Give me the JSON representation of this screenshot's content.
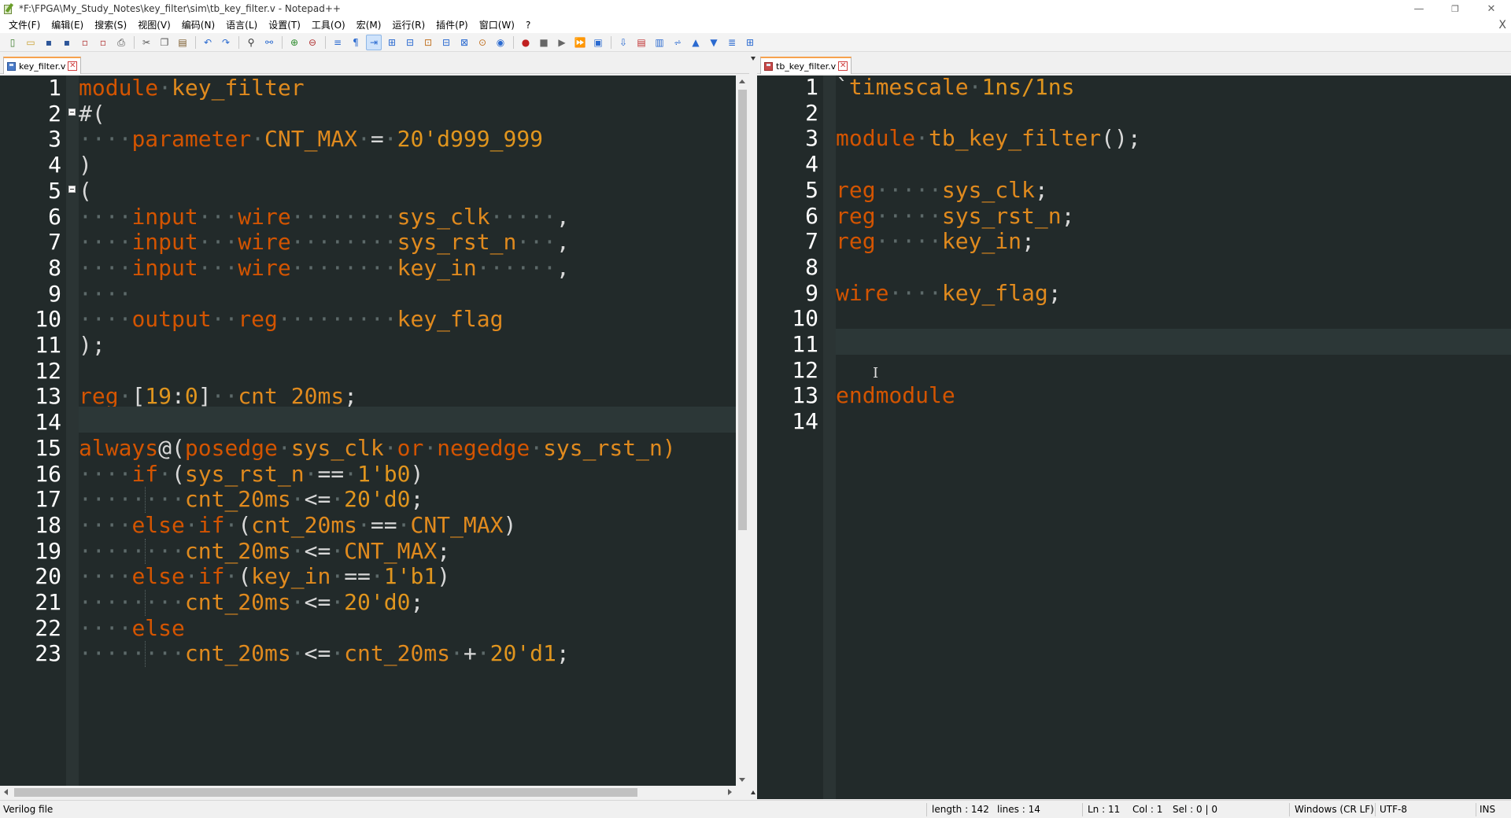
{
  "window": {
    "title": "*F:\\FPGA\\My_Study_Notes\\key_filter\\sim\\tb_key_filter.v - Notepad++",
    "minimize": "—",
    "restore": "❐",
    "close": "✕"
  },
  "menu": {
    "items": [
      "文件(F)",
      "编辑(E)",
      "搜索(S)",
      "视图(V)",
      "编码(N)",
      "语言(L)",
      "设置(T)",
      "工具(O)",
      "宏(M)",
      "运行(R)",
      "插件(P)",
      "窗口(W)",
      "?"
    ],
    "close": "X"
  },
  "toolbar": {
    "icons": [
      "new-file-icon",
      "open-file-icon",
      "save-icon",
      "save-all-icon",
      "close-icon",
      "close-all-icon",
      "print-icon",
      "cut-icon",
      "copy-icon",
      "paste-icon",
      "undo-icon",
      "redo-icon",
      "find-icon",
      "replace-icon",
      "zoom-in-icon",
      "zoom-out-icon",
      "sync-vertical-icon",
      "sync-horizontal-icon",
      "word-wrap-icon",
      "show-all-chars-icon",
      "indent-guide-icon",
      "udl-icon",
      "doc-map-icon",
      "function-list-icon",
      "folder-workspace-icon",
      "monitor-icon",
      "record-macro-icon",
      "stop-macro-icon",
      "play-macro-icon",
      "run-macro-multiple-icon",
      "save-macro-icon",
      "compare-icon",
      "compare-clear-icon",
      "compare-first-icon",
      "compare-prev-icon",
      "compare-next-icon",
      "compare-last-icon",
      "compare-nav-icon",
      "compare-panel-icon"
    ],
    "glyphs": [
      "▯",
      "▭",
      "▪",
      "▪",
      "▫",
      "▫",
      "⎙",
      "✂",
      "❐",
      "▤",
      "↶",
      "↷",
      "⚲",
      "⚯",
      "⊕",
      "⊖",
      "≡",
      "¶",
      "⇥",
      "⊞",
      "⊟",
      "⊡",
      "⊟",
      "⊠",
      "⊙",
      "◉",
      "●",
      "■",
      "▶",
      "⏩",
      "▣",
      "⇩",
      "▤",
      "▥",
      "⩫",
      "▲",
      "▼",
      "≣",
      "⊞"
    ],
    "active_index": 18
  },
  "left_pane": {
    "tab_label": "key_filter.v",
    "lines": [
      [
        [
          "kw",
          "module"
        ],
        [
          "ws",
          "·"
        ],
        [
          "id",
          "key_filter"
        ]
      ],
      [
        [
          "op",
          "#("
        ]
      ],
      [
        [
          "ws",
          "····"
        ],
        [
          "kw",
          "parameter"
        ],
        [
          "ws",
          "·"
        ],
        [
          "id",
          "CNT_MAX"
        ],
        [
          "ws",
          "·"
        ],
        [
          "op",
          "="
        ],
        [
          "ws",
          "·"
        ],
        [
          "num",
          "20'd999_999"
        ]
      ],
      [
        [
          "op",
          ")"
        ]
      ],
      [
        [
          "op",
          "("
        ]
      ],
      [
        [
          "ws",
          "····"
        ],
        [
          "kw",
          "input"
        ],
        [
          "ws",
          "···"
        ],
        [
          "kw",
          "wire"
        ],
        [
          "ws",
          "········"
        ],
        [
          "id",
          "sys_clk"
        ],
        [
          "ws",
          "·····"
        ],
        [
          "op",
          ","
        ]
      ],
      [
        [
          "ws",
          "····"
        ],
        [
          "kw",
          "input"
        ],
        [
          "ws",
          "···"
        ],
        [
          "kw",
          "wire"
        ],
        [
          "ws",
          "········"
        ],
        [
          "id",
          "sys_rst_n"
        ],
        [
          "ws",
          "···"
        ],
        [
          "op",
          ","
        ]
      ],
      [
        [
          "ws",
          "····"
        ],
        [
          "kw",
          "input"
        ],
        [
          "ws",
          "···"
        ],
        [
          "kw",
          "wire"
        ],
        [
          "ws",
          "········"
        ],
        [
          "id",
          "key_in"
        ],
        [
          "ws",
          "······"
        ],
        [
          "op",
          ","
        ]
      ],
      [
        [
          "ws",
          "····"
        ]
      ],
      [
        [
          "ws",
          "····"
        ],
        [
          "kw",
          "output"
        ],
        [
          "ws",
          "··"
        ],
        [
          "kw",
          "reg"
        ],
        [
          "ws",
          "·········"
        ],
        [
          "id",
          "key_flag"
        ]
      ],
      [
        [
          "op",
          ");"
        ]
      ],
      [],
      [
        [
          "kw",
          "reg"
        ],
        [
          "ws",
          "·"
        ],
        [
          "op",
          "["
        ],
        [
          "num",
          "19"
        ],
        [
          "op",
          ":"
        ],
        [
          "num",
          "0"
        ],
        [
          "op",
          "]"
        ],
        [
          "ws",
          "··"
        ],
        [
          "id",
          "cnt_20ms"
        ],
        [
          "op",
          ";"
        ]
      ],
      [],
      [
        [
          "kw",
          "always"
        ],
        [
          "op",
          "@("
        ],
        [
          "kw",
          "posedge"
        ],
        [
          "ws",
          "·"
        ],
        [
          "id",
          "sys_clk"
        ],
        [
          "ws",
          "·"
        ],
        [
          "kw",
          "or"
        ],
        [
          "ws",
          "·"
        ],
        [
          "kw",
          "negedge"
        ],
        [
          "ws",
          "·"
        ],
        [
          "id",
          "sys_rst_n)"
        ]
      ],
      [
        [
          "ws",
          "····"
        ],
        [
          "kw",
          "if"
        ],
        [
          "ws",
          "·"
        ],
        [
          "op",
          "("
        ],
        [
          "id",
          "sys_rst_n"
        ],
        [
          "ws",
          "·"
        ],
        [
          "op",
          "=="
        ],
        [
          "ws",
          "·"
        ],
        [
          "num",
          "1'b0"
        ],
        [
          "op",
          ")"
        ]
      ],
      [
        [
          "ws",
          "····"
        ],
        [
          "ws",
          "····"
        ],
        [
          "id",
          "cnt_20ms"
        ],
        [
          "ws",
          "·"
        ],
        [
          "op",
          "<="
        ],
        [
          "ws",
          "·"
        ],
        [
          "num",
          "20'd0"
        ],
        [
          "op",
          ";"
        ]
      ],
      [
        [
          "ws",
          "····"
        ],
        [
          "kw",
          "else"
        ],
        [
          "ws",
          "·"
        ],
        [
          "kw",
          "if"
        ],
        [
          "ws",
          "·"
        ],
        [
          "op",
          "("
        ],
        [
          "id",
          "cnt_20ms"
        ],
        [
          "ws",
          "·"
        ],
        [
          "op",
          "=="
        ],
        [
          "ws",
          "·"
        ],
        [
          "id",
          "CNT_MAX"
        ],
        [
          "op",
          ")"
        ]
      ],
      [
        [
          "ws",
          "····"
        ],
        [
          "ws",
          "····"
        ],
        [
          "id",
          "cnt_20ms"
        ],
        [
          "ws",
          "·"
        ],
        [
          "op",
          "<="
        ],
        [
          "ws",
          "·"
        ],
        [
          "id",
          "CNT_MAX"
        ],
        [
          "op",
          ";"
        ]
      ],
      [
        [
          "ws",
          "····"
        ],
        [
          "kw",
          "else"
        ],
        [
          "ws",
          "·"
        ],
        [
          "kw",
          "if"
        ],
        [
          "ws",
          "·"
        ],
        [
          "op",
          "("
        ],
        [
          "id",
          "key_in"
        ],
        [
          "ws",
          "·"
        ],
        [
          "op",
          "=="
        ],
        [
          "ws",
          "·"
        ],
        [
          "num",
          "1'b1"
        ],
        [
          "op",
          ")"
        ]
      ],
      [
        [
          "ws",
          "····"
        ],
        [
          "ws",
          "····"
        ],
        [
          "id",
          "cnt_20ms"
        ],
        [
          "ws",
          "·"
        ],
        [
          "op",
          "<="
        ],
        [
          "ws",
          "·"
        ],
        [
          "num",
          "20'd0"
        ],
        [
          "op",
          ";"
        ]
      ],
      [
        [
          "ws",
          "····"
        ],
        [
          "kw",
          "else"
        ]
      ],
      [
        [
          "ws",
          "····"
        ],
        [
          "ws",
          "····"
        ],
        [
          "id",
          "cnt_20ms"
        ],
        [
          "ws",
          "·"
        ],
        [
          "op",
          "<="
        ],
        [
          "ws",
          "·"
        ],
        [
          "id",
          "cnt_20ms"
        ],
        [
          "ws",
          "·"
        ],
        [
          "op",
          "+"
        ],
        [
          "ws",
          "·"
        ],
        [
          "num",
          "20'd1"
        ],
        [
          "op",
          ";"
        ]
      ]
    ],
    "current_line": 14,
    "fold_lines": [
      2,
      5
    ],
    "guide_lines": [
      17,
      19,
      21,
      23
    ]
  },
  "right_pane": {
    "tab_label": "tb_key_filter.v",
    "lines": [
      [
        [
          "op",
          "`"
        ],
        [
          "id",
          "timescale"
        ],
        [
          "ws",
          "·"
        ],
        [
          "num",
          "1ns/1ns"
        ]
      ],
      [],
      [
        [
          "kw",
          "module"
        ],
        [
          "ws",
          "·"
        ],
        [
          "id",
          "tb_key_filter"
        ],
        [
          "op",
          "();"
        ]
      ],
      [],
      [
        [
          "kw",
          "reg"
        ],
        [
          "ws",
          "·····"
        ],
        [
          "id",
          "sys_clk"
        ],
        [
          "op",
          ";"
        ]
      ],
      [
        [
          "kw",
          "reg"
        ],
        [
          "ws",
          "·····"
        ],
        [
          "id",
          "sys_rst_n"
        ],
        [
          "op",
          ";"
        ]
      ],
      [
        [
          "kw",
          "reg"
        ],
        [
          "ws",
          "·····"
        ],
        [
          "id",
          "key_in"
        ],
        [
          "op",
          ";"
        ]
      ],
      [],
      [
        [
          "kw",
          "wire"
        ],
        [
          "ws",
          "····"
        ],
        [
          "id",
          "key_flag"
        ],
        [
          "op",
          ";"
        ]
      ],
      [],
      [],
      [],
      [
        [
          "kw",
          "endmodule"
        ]
      ],
      []
    ],
    "current_line": 11
  },
  "status": {
    "file_type": "Verilog file",
    "length": "length : 142",
    "lines": "lines : 14",
    "ln": "Ln : 11",
    "col": "Col : 1",
    "sel": "Sel : 0 | 0",
    "eol": "Windows (CR LF)",
    "encoding": "UTF-8",
    "mode": "INS"
  },
  "colors": {
    "editor_bg": "#222a2a",
    "keyword": "#d35400",
    "identifier": "#e08a1e",
    "tab_accent": "#f7a24d"
  }
}
